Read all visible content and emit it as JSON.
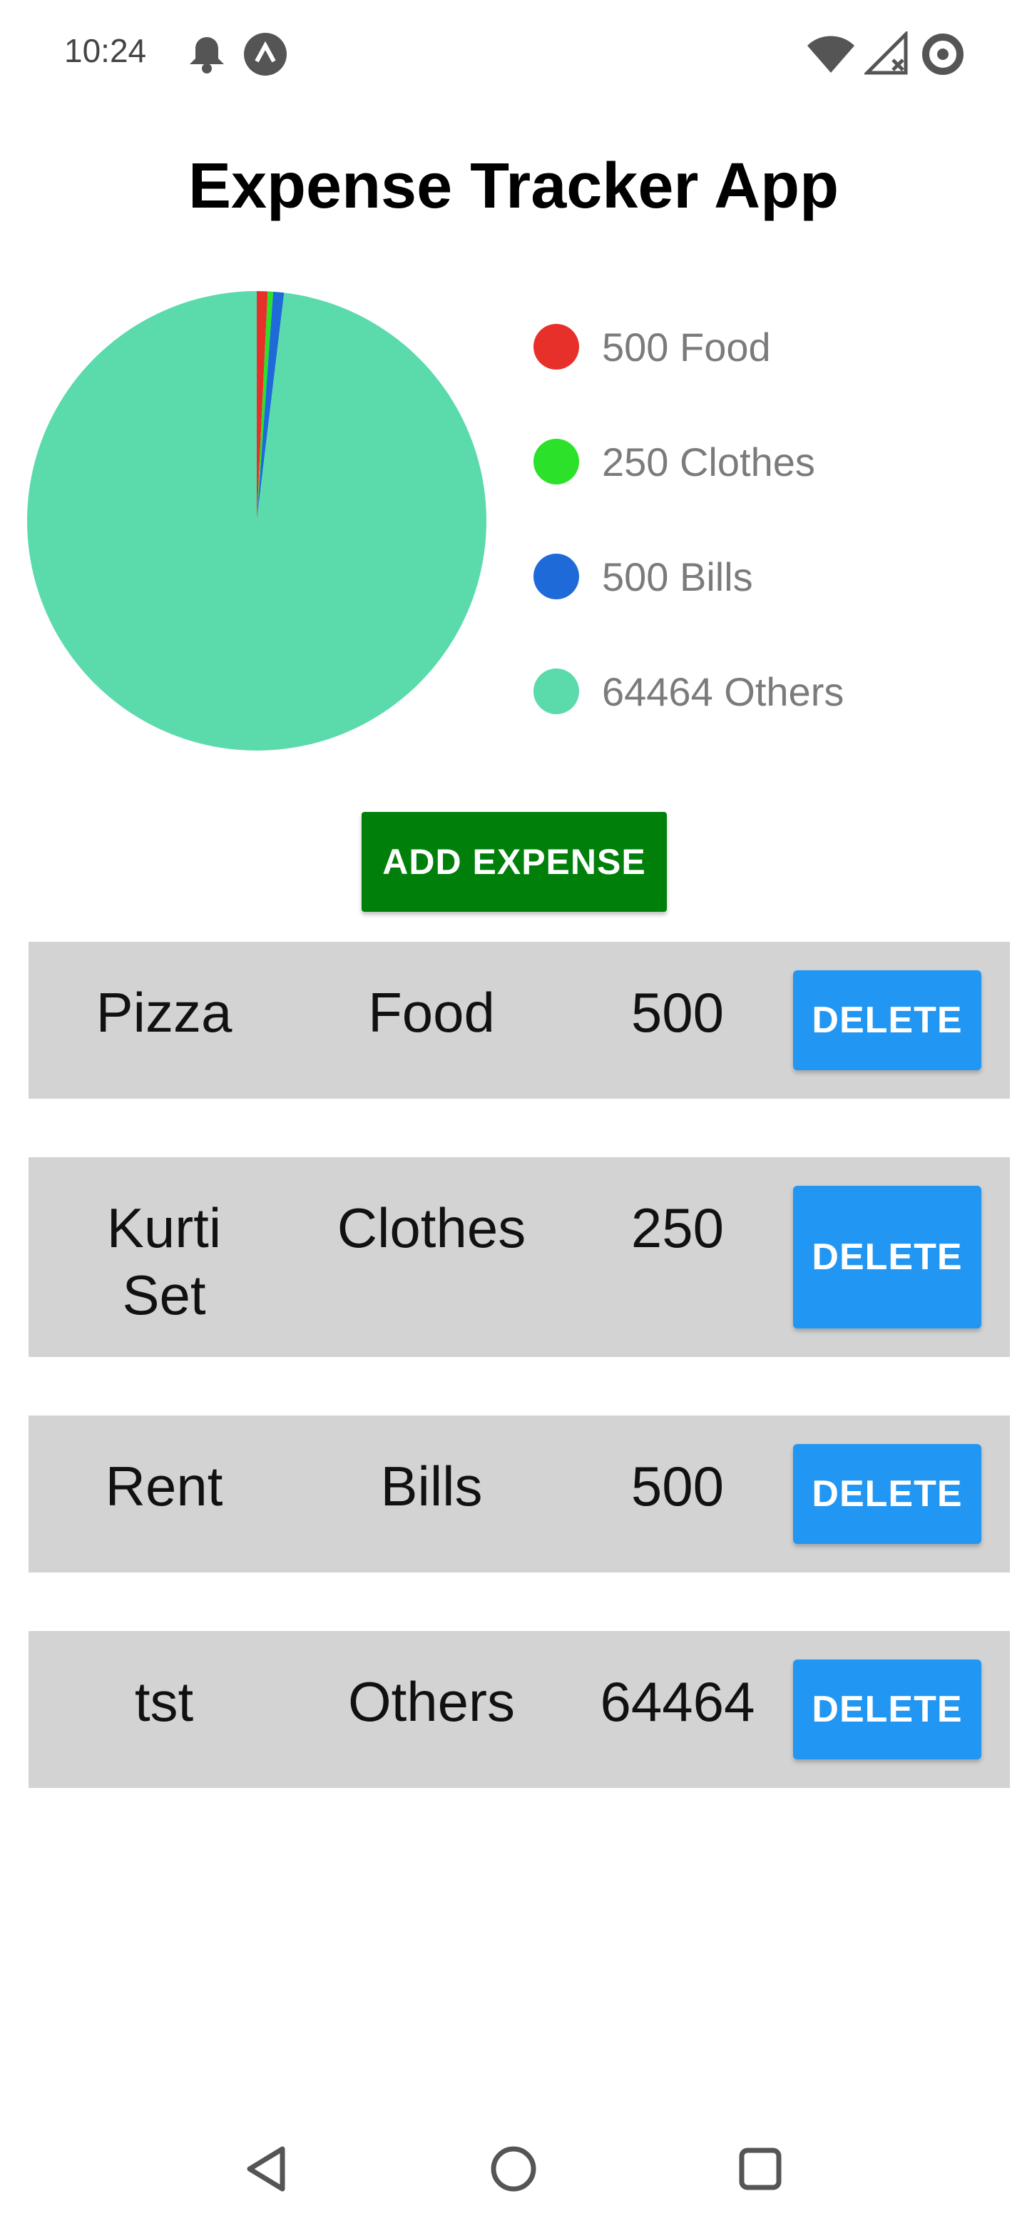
{
  "status_bar": {
    "time": "10:24"
  },
  "app": {
    "title": "Expense Tracker App"
  },
  "chart_data": {
    "type": "pie",
    "categories": [
      "Food",
      "Clothes",
      "Bills",
      "Others"
    ],
    "values": [
      500,
      250,
      500,
      64464
    ],
    "colors": [
      "#e8302a",
      "#2ce12a",
      "#1f6ad9",
      "#5bdaac"
    ],
    "legend_labels": [
      "500 Food",
      "250 Clothes",
      "500 Bills",
      "64464 Others"
    ],
    "legend_position": "right"
  },
  "actions": {
    "add_label": "ADD EXPENSE"
  },
  "expenses": [
    {
      "name": "Pizza",
      "category": "Food",
      "amount": "500",
      "delete_label": "DELETE"
    },
    {
      "name": "Kurti Set",
      "category": "Clothes",
      "amount": "250",
      "delete_label": "DELETE"
    },
    {
      "name": "Rent",
      "category": "Bills",
      "amount": "500",
      "delete_label": "DELETE"
    },
    {
      "name": "tst",
      "category": "Others",
      "amount": "64464",
      "delete_label": "DELETE"
    }
  ]
}
